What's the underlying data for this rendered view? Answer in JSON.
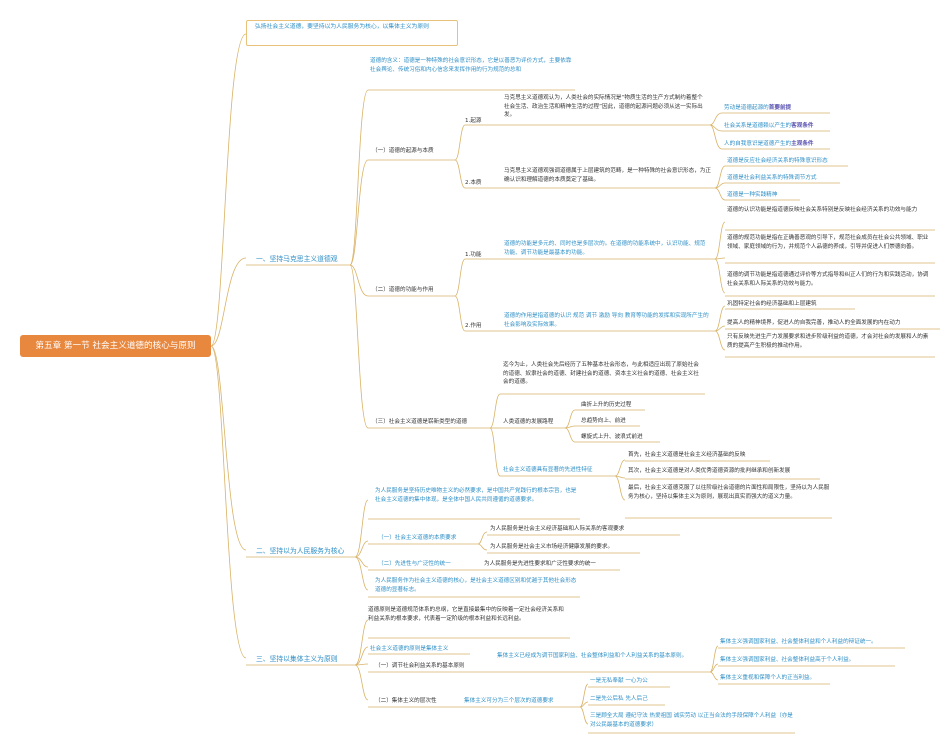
{
  "root": "第五章 第一节 社会主义道德的核心与原则",
  "summary": "弘扬社会主义道德，要坚持以为人民服务为核心，以集体主义为原则",
  "s1": {
    "title": "一、坚持马克思主义道德观",
    "def": "道德的含义：道德是一种特殊的社会意识形态，它是以善恶为评价方式，主要依靠社会舆论、传统习俗和内心信念来发挥作用的行为规范的总和",
    "sub1": {
      "title": "（一）道德的起源与本质",
      "a": {
        "label": "1.起源",
        "text": "马克思主义道德观认为，人类社会的实际情况是“物质生活的生产方式制约着整个社会生活、政治生活和精神生活的过程”因此，道德的起源问题必须从这一实际出发。",
        "items": [
          {
            "pre": "劳动是道德起源的",
            "key": "首要前提"
          },
          {
            "pre": "社会关系是道德赖以产生的",
            "key": "客观条件"
          },
          {
            "pre": "人的自我意识是道德产生的",
            "key": "主观条件"
          }
        ]
      },
      "b": {
        "label": "2.本质",
        "text": "马克思主义道德观强调道德属于上层建筑的范畴，是一种特殊的社会意识形态，为正确认识和理解道德的本质奠定了基础。",
        "items": [
          "道德是反应社会经济关系的特殊意识形态",
          "道德是社会利益关系的特殊调节方式",
          "道德是一种实践精神"
        ]
      }
    },
    "sub2": {
      "title": "（二）道德的功能与作用",
      "a": {
        "label": "1.功能",
        "text": "道德的功能是多元的、同时也是多层次的。在道德的功能系统中，认识功能、规范功能、调节功能是最基本的功能。",
        "items": [
          "道德的认识功能是指道德反映社会关系特别是反映社会经济关系的功效与能力",
          "道德的规范功能是指在正确善恶观的引导下，规范社会成员在社会公共领域、职业领域、家庭领域的行为，并规范个人品德的养成，引导并促进人们崇德向善。",
          "道德的调节功能是指道德通过评价等方式指导和纠正人们的行为和实践活动，协调社会关系和人际关系的功效与能力。"
        ]
      },
      "b": {
        "label": "2.作用",
        "text": "道德的作用是指道德的认识 规范 调节 激励 导向 教育等功能的发挥和实现所产生的社会影响及实际效果。",
        "items": [
          "巩固特定社会的经济基础和上层建筑",
          "提高人的精神境界，促进人的自我完善，推动人的全面发展的内在动力",
          "只有反映先进生产力发展要求和进步阶级利益的道德，才会对社会的发展和人的素质的提高产生积极的推动作用。"
        ]
      }
    },
    "sub3": {
      "title": "（三）社会主义道德是崭新类型的道德",
      "intro": "迄今为止，人类社会先后经历了五种基本社会形态，与此相适应出现了原始社会的道德、奴隶社会的道德、封建社会的道德、资本主义社会的道德、社会主义社会的道德。",
      "a": {
        "label": "人类道德的发展路程",
        "items": [
          "曲折上升的历史过程",
          "总趋势向上、前进",
          "螺旋式上升、波浪式前进"
        ]
      },
      "b": {
        "label": "社会主义道德具有显著的先进性特征",
        "items": [
          "首先，社会主义道德是社会主义经济基础的反映",
          "其次，社会主义道德是对人类优秀道德资源的批判继承和创新发展",
          "最后，社会主义道德克服了以往阶级社会道德的片面性和局限性，坚持以为人民服务为核心，坚持以集体主义为原则，展现出真实而强大的道义力量。"
        ]
      }
    }
  },
  "s2": {
    "title": "二、坚持以为人民服务为核心",
    "intro": "为人民服务是坚持历史唯物主义的必然要求，是中国共产党践行的根本宗旨，也是社会主义道德的集中体现，是全体中国人民共同遵循的道德要求。",
    "sub1": {
      "title": "（一）社会主义道德的本质要求",
      "items": [
        "为人民服务是社会主义经济基础和人际关系的客观要求",
        "为人民服务是社会主义市场经济健康发展的要求。"
      ]
    },
    "sub2": {
      "title": "（二）先进性与广泛性的统一",
      "text": "为人民服务是先进性要求和广泛性要求的统一"
    },
    "outro": "为人民服务作为社会主义道德的核心，是社会主义道德区别和优越于其他社会形态道德的显著标志。"
  },
  "s3": {
    "title": "三、坚持以集体主义为原则",
    "intro": "道德原则是道德规范体系的总纲，它是直接最集中的反映着一定社会经济关系和利益关系的根本要求，代表着一定阶级的根本利益和长远利益。",
    "principle": "社会主义道德的原则是集体主义",
    "sub1": {
      "title": "（一）调节社会利益关系的基本原则",
      "text": "集体主义已经成为调节国家利益、社会整体利益和个人利益关系的基本原则。",
      "items": [
        "集体主义强调国家利益、社会整体利益和个人利益的辩证统一。",
        "集体主义强调国家利益、社会整体利益高于个人利益。",
        "集体主义重视和保障个人的正当利益。"
      ]
    },
    "sub2": {
      "title": "（二）集体主义的层次性",
      "text": "集体主义可分为三个层次的道德要求",
      "items": [
        "一是无私奉献 一心为公",
        "二是先公后私 先人后己",
        "三是顾全大局 遵纪守法 热爱祖国 诚实劳动 以正当合法的手段保障个人利益（亦是对公民最基本的道德要求）"
      ]
    }
  },
  "colors": {
    "root": "#e8873e",
    "line": "#d9b266",
    "blue": "#2f8fc6",
    "purple": "#5b54b0",
    "text": "#333333"
  }
}
